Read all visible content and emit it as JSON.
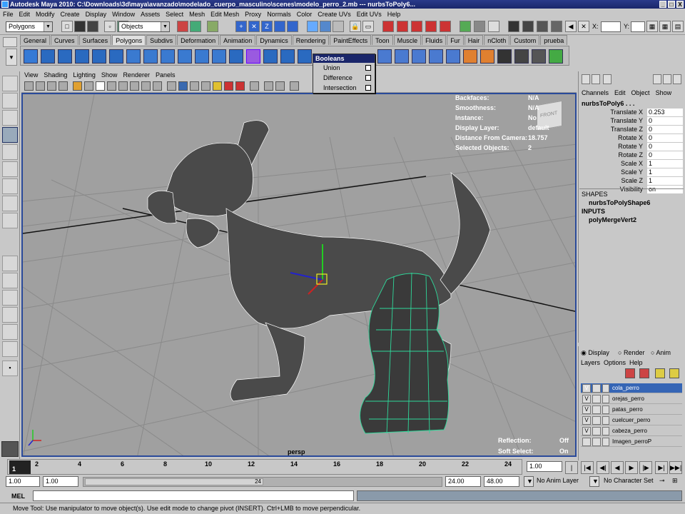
{
  "window": {
    "title": "Autodesk Maya 2010: C:\\Downloads\\3d\\maya\\avanzado\\modelado_cuerpo_masculino\\scenes\\modelo_perro_2.mb  ---  nurbsToPoly6...",
    "controls": [
      "_",
      "□",
      "X"
    ]
  },
  "menus": [
    "File",
    "Edit",
    "Modify",
    "Create",
    "Display",
    "Window",
    "Assets",
    "Select",
    "Mesh",
    "Edit Mesh",
    "Proxy",
    "Normals",
    "Color",
    "Create UVs",
    "Edit UVs",
    "Help"
  ],
  "statusline": {
    "menuset": "Polygons",
    "selection_field": "Objects",
    "x_label": "X:",
    "y_label": "Y:"
  },
  "shelf_tabs": [
    "General",
    "Curves",
    "Surfaces",
    "Polygons",
    "Subdivs",
    "Deformation",
    "Animation",
    "Dynamics",
    "Rendering",
    "PaintEffects",
    "Toon",
    "Muscle",
    "Fluids",
    "Fur",
    "Hair",
    "nCloth",
    "Custom",
    "prueba"
  ],
  "shelf_active": "Polygons",
  "booleans_menu": {
    "title": "Booleans",
    "items": [
      "Union",
      "Difference",
      "Intersection"
    ]
  },
  "panel_menu": [
    "View",
    "Shading",
    "Lighting",
    "Show",
    "Renderer",
    "Panels"
  ],
  "hud": [
    {
      "label": "Backfaces:",
      "value": "N/A"
    },
    {
      "label": "Smoothness:",
      "value": "N/A"
    },
    {
      "label": "Instance:",
      "value": "No"
    },
    {
      "label": "Display Layer:",
      "value": "default"
    },
    {
      "label": "Distance From Camera:",
      "value": "18.757"
    },
    {
      "label": "Selected Objects:",
      "value": "2"
    }
  ],
  "view_cube_label": "FRONT",
  "camera_name": "persp",
  "hud_bottom": [
    {
      "label": "Reflection:",
      "value": "Off"
    },
    {
      "label": "Soft Select:",
      "value": "On"
    }
  ],
  "channel_box": {
    "menu": [
      "Channels",
      "Edit",
      "Object",
      "Show"
    ],
    "object_name": "nurbsToPoly6 . . .",
    "attributes": [
      {
        "name": "Translate X",
        "value": "0.253"
      },
      {
        "name": "Translate Y",
        "value": "0"
      },
      {
        "name": "Translate Z",
        "value": "0"
      },
      {
        "name": "Rotate X",
        "value": "0"
      },
      {
        "name": "Rotate Y",
        "value": "0"
      },
      {
        "name": "Rotate Z",
        "value": "0"
      },
      {
        "name": "Scale X",
        "value": "1"
      },
      {
        "name": "Scale Y",
        "value": "1"
      },
      {
        "name": "Scale Z",
        "value": "1"
      },
      {
        "name": "Visibility",
        "value": "on"
      }
    ],
    "shapes_header": "SHAPES",
    "shape_name": "nurbsToPolyShape6",
    "inputs_header": "INPUTS",
    "input_name": "polyMergeVert2"
  },
  "layer_editor": {
    "tabs": [
      "Display",
      "Render",
      "Anim"
    ],
    "menu": [
      "Layers",
      "Options",
      "Help"
    ],
    "layers": [
      {
        "v": "V",
        "name": "cola_perro",
        "selected": true
      },
      {
        "v": "V",
        "name": "orejas_perro",
        "selected": false
      },
      {
        "v": "V",
        "name": "patas_perro",
        "selected": false
      },
      {
        "v": "V",
        "name": "cuelcuer_perro",
        "selected": false
      },
      {
        "v": "V",
        "name": "cabeza_perro",
        "selected": false
      },
      {
        "v": "",
        "name": "Imagen_perroP",
        "selected": false
      }
    ]
  },
  "time_slider": {
    "ticks": [
      "1",
      "2",
      "4",
      "6",
      "8",
      "10",
      "12",
      "14",
      "16",
      "18",
      "20",
      "22",
      "24"
    ],
    "current_frame": "1.00"
  },
  "range": {
    "start": "1.00",
    "start2": "1.00",
    "slider_label": "24",
    "end": "24.00",
    "end2": "48.00",
    "anim_layer": "No Anim Layer",
    "character_set": "No Character Set"
  },
  "mel_label": "MEL",
  "help_line": "Move Tool: Use manipulator to move object(s). Use edit mode to change pivot (INSERT).  Ctrl+LMB to move perpendicular."
}
